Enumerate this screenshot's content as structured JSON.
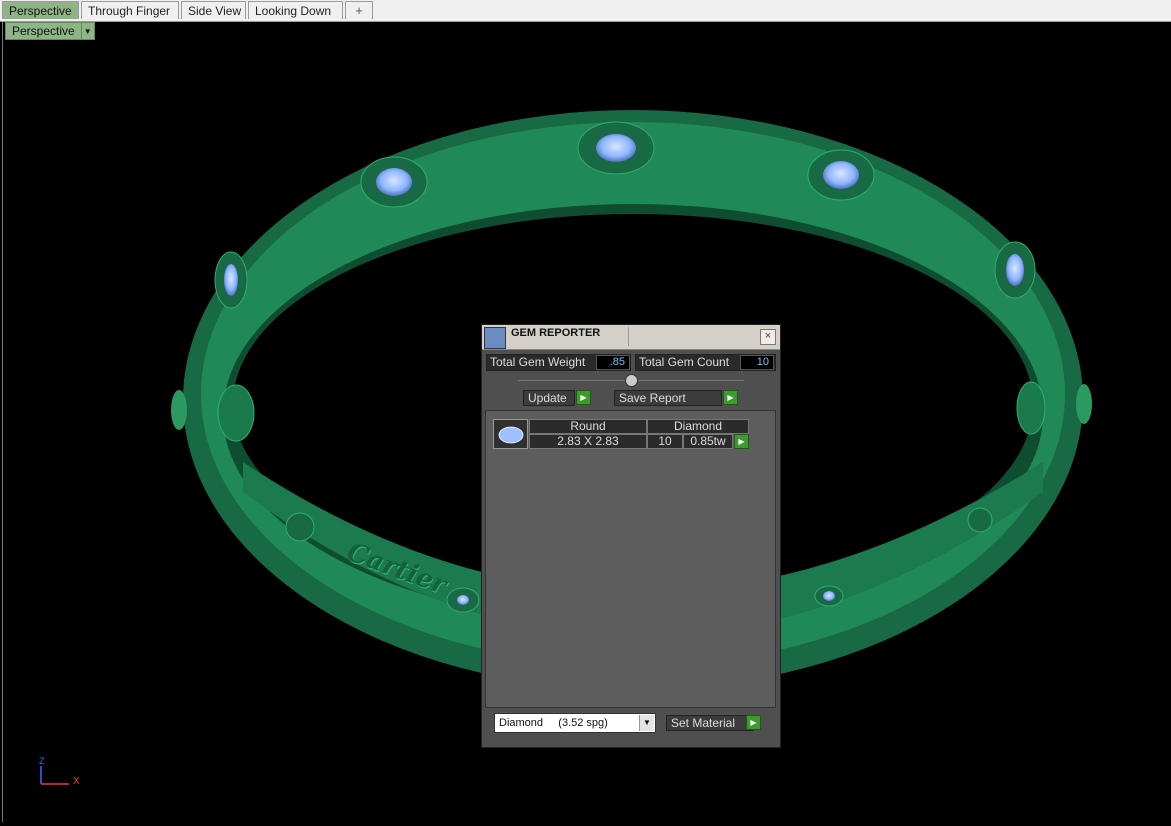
{
  "tabs": [
    {
      "label": "Perspective",
      "active": true
    },
    {
      "label": "Through Finger"
    },
    {
      "label": "Side View"
    },
    {
      "label": "Looking Down"
    }
  ],
  "add_tab_symbol": "+",
  "viewport": {
    "label": "Perspective",
    "dropdown_symbol": "▼"
  },
  "axis": {
    "z": "Z",
    "x": "X"
  },
  "ring": {
    "engraving": "Cartier",
    "color": "#1e8a5a",
    "gem_color": "#8eb6ff"
  },
  "panel": {
    "title": "GEM REPORTER",
    "close_symbol": "×",
    "total_weight_label": "Total Gem Weight",
    "total_weight_value": ".85",
    "total_count_label": "Total Gem Count",
    "total_count_value": "10",
    "update_label": "Update",
    "save_report_label": "Save Report",
    "gem_row": {
      "shape": "Round",
      "material": "Diamond",
      "size": "2.83 X 2.83",
      "count": "10",
      "weight": "0.85tw"
    },
    "material_select": "Diamond     (3.52 spg)",
    "set_material_label": "Set Material"
  }
}
